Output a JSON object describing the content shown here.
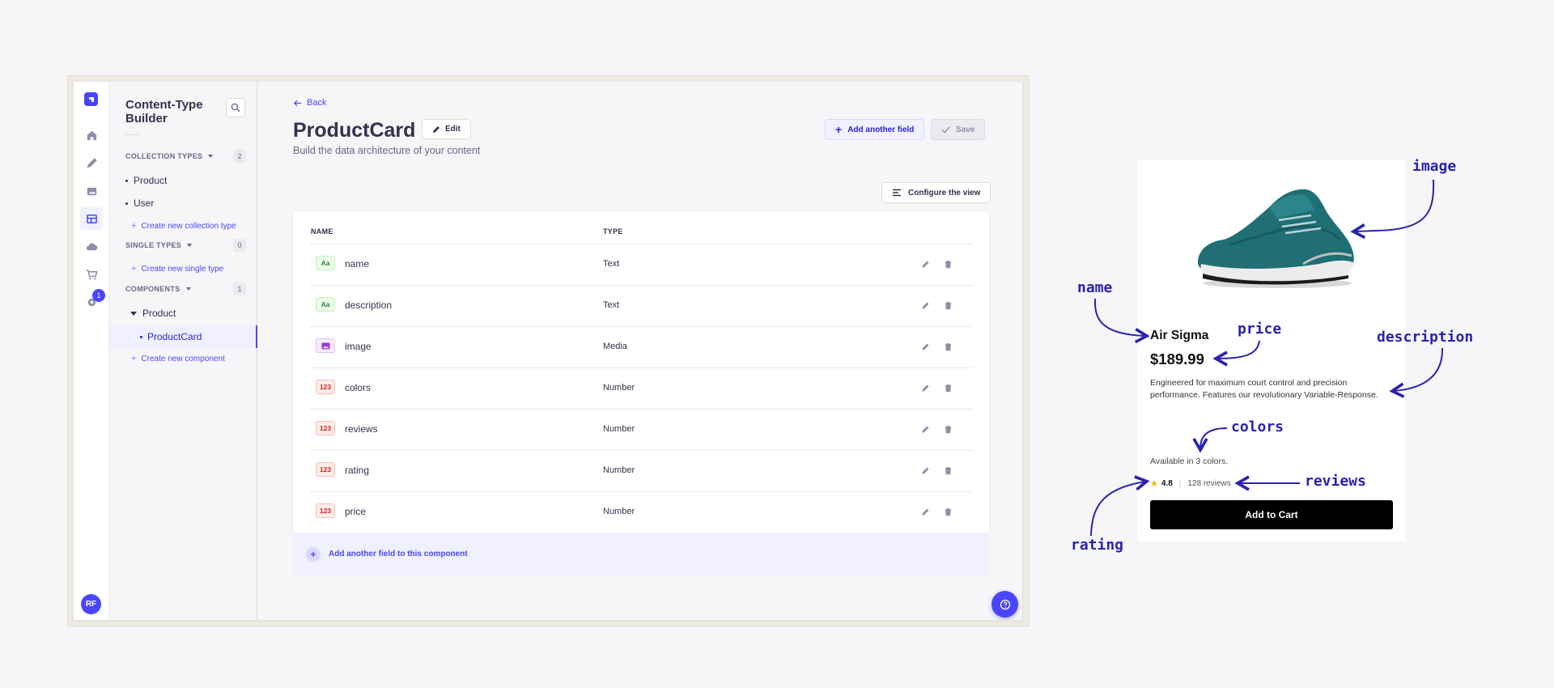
{
  "sidebar": {
    "title": "Content-Type Builder",
    "collection_types": {
      "label": "COLLECTION TYPES",
      "count": "2",
      "items": [
        "Product",
        "User"
      ],
      "create": "Create new collection type"
    },
    "single_types": {
      "label": "SINGLE TYPES",
      "count": "0",
      "create": "Create new single type"
    },
    "components": {
      "label": "COMPONENTS",
      "count": "1",
      "group": "Product",
      "active_item": "ProductCard",
      "create": "Create new component"
    }
  },
  "nav": {
    "badge": "1",
    "avatar": "RF"
  },
  "header": {
    "back": "Back",
    "title": "ProductCard",
    "edit": "Edit",
    "subtitle": "Build the data architecture of your content",
    "add_field": "Add another field",
    "save": "Save",
    "configure": "Configure the view"
  },
  "table": {
    "columns": [
      "NAME",
      "TYPE"
    ],
    "rows": [
      {
        "icon": "Aa",
        "name": "name",
        "type": "Text"
      },
      {
        "icon": "Aa",
        "name": "description",
        "type": "Text"
      },
      {
        "icon": "",
        "name": "image",
        "type": "Media"
      },
      {
        "icon": "123",
        "name": "colors",
        "type": "Number"
      },
      {
        "icon": "123",
        "name": "reviews",
        "type": "Number"
      },
      {
        "icon": "123",
        "name": "rating",
        "type": "Number"
      },
      {
        "icon": "123",
        "name": "price",
        "type": "Number"
      }
    ],
    "add_component_field": "Add another field to this component"
  },
  "card": {
    "name": "Air Sigma",
    "price": "$189.99",
    "description": "Engineered for maximum court control and precision performance. Features our revolutionary Variable-Response.",
    "colors": "Available in 3 colors.",
    "rating": "4.8",
    "reviews": "128 reviews",
    "cta": "Add to Cart"
  },
  "annotations": {
    "image": "image",
    "name": "name",
    "price": "price",
    "description": "description",
    "colors": "colors",
    "reviews": "reviews",
    "rating": "rating"
  },
  "colors": {
    "accent": "#4945ff",
    "annotation": "#2b22b0"
  }
}
